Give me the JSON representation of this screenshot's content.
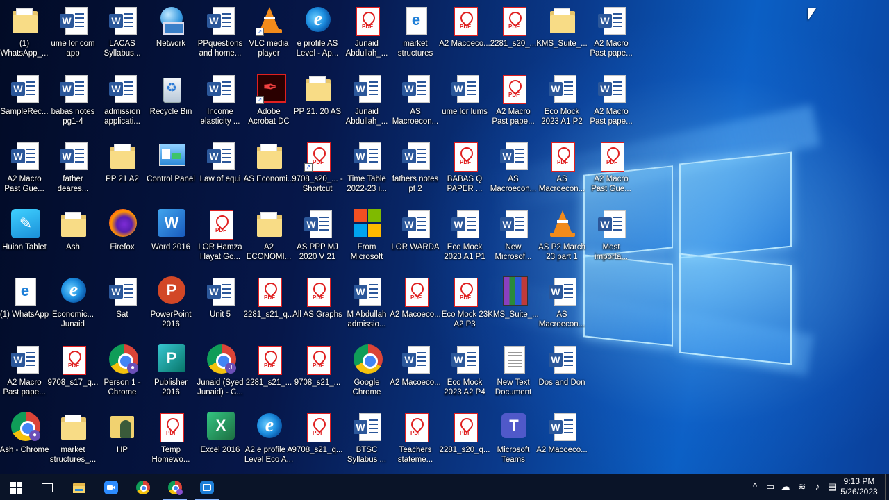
{
  "desktop": {
    "icons": [
      {
        "label": "(1) WhatsApp_...",
        "kind": "folder",
        "col": 0,
        "row": 0
      },
      {
        "label": "ume lor com app",
        "kind": "word",
        "col": 1,
        "row": 0
      },
      {
        "label": "LACAS Syllabus...",
        "kind": "word",
        "col": 2,
        "row": 0
      },
      {
        "label": "Network",
        "kind": "network",
        "col": 3,
        "row": 0
      },
      {
        "label": "PPquestions and home...",
        "kind": "word",
        "col": 4,
        "row": 0
      },
      {
        "label": "VLC media player",
        "kind": "vlc",
        "col": 5,
        "row": 0,
        "shortcut": true
      },
      {
        "label": "e profile AS Level - Ap...",
        "kind": "edge",
        "col": 6,
        "row": 0
      },
      {
        "label": "Junaid Abdullah_...",
        "kind": "pdf",
        "col": 7,
        "row": 0
      },
      {
        "label": "market structures",
        "kind": "edgedoc",
        "col": 8,
        "row": 0
      },
      {
        "label": "A2 Macoeco...",
        "kind": "pdf",
        "col": 9,
        "row": 0
      },
      {
        "label": "2281_s20_...",
        "kind": "pdf",
        "col": 10,
        "row": 0
      },
      {
        "label": "KMS_Suite_...",
        "kind": "folder",
        "col": 11,
        "row": 0
      },
      {
        "label": "A2 Macro Past pape...",
        "kind": "word",
        "col": 12,
        "row": 0
      },
      {
        "label": "SampleRec...",
        "kind": "word",
        "col": 0,
        "row": 1
      },
      {
        "label": "babas notes pg1-4",
        "kind": "word",
        "col": 1,
        "row": 1
      },
      {
        "label": "admission applicati...",
        "kind": "word",
        "col": 2,
        "row": 1
      },
      {
        "label": "Recycle Bin",
        "kind": "recycle",
        "col": 3,
        "row": 1
      },
      {
        "label": "Income elasticity ...",
        "kind": "word",
        "col": 4,
        "row": 1
      },
      {
        "label": "Adobe Acrobat DC",
        "kind": "acrobat",
        "col": 5,
        "row": 1,
        "shortcut": true
      },
      {
        "label": "PP 21. 20 AS",
        "kind": "folder",
        "col": 6,
        "row": 1
      },
      {
        "label": "Junaid Abdullah_...",
        "kind": "word",
        "col": 7,
        "row": 1
      },
      {
        "label": "AS Macroecon...",
        "kind": "word",
        "col": 8,
        "row": 1
      },
      {
        "label": "ume lor lums",
        "kind": "word",
        "col": 9,
        "row": 1
      },
      {
        "label": "A2 Macro Past pape...",
        "kind": "pdf",
        "col": 10,
        "row": 1
      },
      {
        "label": "Eco Mock 2023 A1 P2",
        "kind": "word",
        "col": 11,
        "row": 1
      },
      {
        "label": "A2 Macro Past pape...",
        "kind": "word",
        "col": 12,
        "row": 1
      },
      {
        "label": "A2 Macro Past Gue...",
        "kind": "word",
        "col": 0,
        "row": 2
      },
      {
        "label": "father deares...",
        "kind": "word",
        "col": 1,
        "row": 2
      },
      {
        "label": "PP 21 A2",
        "kind": "folder",
        "col": 2,
        "row": 2
      },
      {
        "label": "Control Panel",
        "kind": "cp",
        "col": 3,
        "row": 2
      },
      {
        "label": "Law of equi",
        "kind": "word",
        "col": 4,
        "row": 2
      },
      {
        "label": "AS Economi...",
        "kind": "folder",
        "col": 5,
        "row": 2
      },
      {
        "label": "9708_s20_... - Shortcut",
        "kind": "pdf",
        "col": 6,
        "row": 2,
        "shortcut": true
      },
      {
        "label": "Time Table 2022-23 i...",
        "kind": "word",
        "col": 7,
        "row": 2
      },
      {
        "label": "fathers notes pt 2",
        "kind": "word",
        "col": 8,
        "row": 2
      },
      {
        "label": "BABAS Q PAPER ...",
        "kind": "pdf",
        "col": 9,
        "row": 2
      },
      {
        "label": "AS Macroecon...",
        "kind": "word",
        "col": 10,
        "row": 2
      },
      {
        "label": "AS Macroecon...",
        "kind": "pdf",
        "col": 11,
        "row": 2
      },
      {
        "label": "A2 Macro Past Gue...",
        "kind": "pdf",
        "col": 12,
        "row": 2
      },
      {
        "label": "Huion Tablet",
        "kind": "huion",
        "col": 0,
        "row": 3
      },
      {
        "label": "Ash",
        "kind": "folder",
        "col": 1,
        "row": 3
      },
      {
        "label": "Firefox",
        "kind": "firefox",
        "col": 2,
        "row": 3
      },
      {
        "label": "Word 2016",
        "kind": "wordapp",
        "col": 3,
        "row": 3
      },
      {
        "label": "LOR Hamza Hayat Go...",
        "kind": "pdf",
        "col": 4,
        "row": 3
      },
      {
        "label": "A2 ECONOMI...",
        "kind": "folder",
        "col": 5,
        "row": 3
      },
      {
        "label": "AS PPP MJ 2020 V 21",
        "kind": "word",
        "col": 6,
        "row": 3
      },
      {
        "label": "From Microsoft",
        "kind": "ms",
        "col": 7,
        "row": 3
      },
      {
        "label": "LOR WARDA",
        "kind": "word",
        "col": 8,
        "row": 3
      },
      {
        "label": "Eco Mock 2023 A1 P1",
        "kind": "word",
        "col": 9,
        "row": 3
      },
      {
        "label": "New Microsof...",
        "kind": "word",
        "col": 10,
        "row": 3
      },
      {
        "label": "AS P2 March 23 part 1",
        "kind": "vlc",
        "col": 11,
        "row": 3
      },
      {
        "label": "Most importa...",
        "kind": "word",
        "col": 12,
        "row": 3
      },
      {
        "label": "(1) WhatsApp",
        "kind": "edgedoc",
        "col": 0,
        "row": 4
      },
      {
        "label": "Economic... Junaid",
        "kind": "edge",
        "col": 1,
        "row": 4
      },
      {
        "label": "Sat",
        "kind": "word",
        "col": 2,
        "row": 4
      },
      {
        "label": "PowerPoint 2016",
        "kind": "ppt",
        "col": 3,
        "row": 4
      },
      {
        "label": "Unit 5",
        "kind": "word",
        "col": 4,
        "row": 4
      },
      {
        "label": "2281_s21_q...",
        "kind": "pdf",
        "col": 5,
        "row": 4
      },
      {
        "label": "All AS Graphs",
        "kind": "pdf",
        "col": 6,
        "row": 4
      },
      {
        "label": "M Abdullah admissio...",
        "kind": "word",
        "col": 7,
        "row": 4
      },
      {
        "label": "A2 Macoeco...",
        "kind": "pdf",
        "col": 8,
        "row": 4
      },
      {
        "label": "Eco Mock 23 A2 P3",
        "kind": "pdf",
        "col": 9,
        "row": 4
      },
      {
        "label": "KMS_Suite_...",
        "kind": "winrar",
        "col": 10,
        "row": 4
      },
      {
        "label": "AS Macroecon...",
        "kind": "word",
        "col": 11,
        "row": 4
      },
      {
        "label": "A2 Macro Past pape...",
        "kind": "word",
        "col": 0,
        "row": 5
      },
      {
        "label": "9708_s17_q...",
        "kind": "pdf",
        "col": 1,
        "row": 5
      },
      {
        "label": "Person 1 - Chrome",
        "kind": "chrome",
        "col": 2,
        "row": 5,
        "avatar": "●"
      },
      {
        "label": "Publisher 2016",
        "kind": "publisher",
        "col": 3,
        "row": 5
      },
      {
        "label": "Junaid (Syed Junaid) - C...",
        "kind": "chrome",
        "col": 4,
        "row": 5,
        "avatar": "J"
      },
      {
        "label": "2281_s21_...",
        "kind": "pdf",
        "col": 5,
        "row": 5
      },
      {
        "label": "9708_s21_...",
        "kind": "pdf",
        "col": 6,
        "row": 5
      },
      {
        "label": "Google Chrome",
        "kind": "chrome",
        "col": 7,
        "row": 5
      },
      {
        "label": "A2 Macoeco...",
        "kind": "word",
        "col": 8,
        "row": 5
      },
      {
        "label": "Eco Mock 2023 A2 P4",
        "kind": "word",
        "col": 9,
        "row": 5
      },
      {
        "label": "New Text Document",
        "kind": "txt",
        "col": 10,
        "row": 5
      },
      {
        "label": "Dos and Don",
        "kind": "word",
        "col": 11,
        "row": 5
      },
      {
        "label": "Ash - Chrome",
        "kind": "chrome",
        "col": 0,
        "row": 6,
        "avatar": "●"
      },
      {
        "label": "market structures_...",
        "kind": "folder",
        "col": 1,
        "row": 6
      },
      {
        "label": "HP",
        "kind": "hp",
        "col": 2,
        "row": 6
      },
      {
        "label": "Temp Homewo...",
        "kind": "pdf",
        "col": 3,
        "row": 6
      },
      {
        "label": "Excel 2016",
        "kind": "excel",
        "col": 4,
        "row": 6
      },
      {
        "label": "A2 e profile A Level Eco A...",
        "kind": "edge",
        "col": 5,
        "row": 6
      },
      {
        "label": "9708_s21_q...",
        "kind": "pdf",
        "col": 6,
        "row": 6
      },
      {
        "label": "BTSC Syllabus ...",
        "kind": "word",
        "col": 7,
        "row": 6
      },
      {
        "label": "Teachers stateme...",
        "kind": "pdf",
        "col": 8,
        "row": 6
      },
      {
        "label": "2281_s20_q...",
        "kind": "pdf",
        "col": 9,
        "row": 6
      },
      {
        "label": "Microsoft Teams",
        "kind": "teams",
        "col": 10,
        "row": 6
      },
      {
        "label": "A2 Macoeco...",
        "kind": "word",
        "col": 11,
        "row": 6
      }
    ]
  },
  "taskbar": {
    "buttons": [
      {
        "name": "start-button",
        "icon": "windows-icon"
      },
      {
        "name": "task-view-button",
        "icon": "task-view-icon"
      },
      {
        "name": "file-explorer-button",
        "icon": "folder-icon"
      },
      {
        "name": "zoom-button",
        "icon": "zoom-icon"
      },
      {
        "name": "chrome-button",
        "icon": "chrome-icon"
      },
      {
        "name": "chrome-profile-button",
        "icon": "chrome-profile-icon",
        "active": true
      },
      {
        "name": "screen-recorder-button",
        "icon": "recorder-icon",
        "active": true
      }
    ],
    "tray": {
      "chevron": "^",
      "time": "9:13 PM",
      "date": "5/26/2023"
    }
  },
  "colors": {
    "taskbar": "#0a1428",
    "word": "#2b579a",
    "pdf": "#e02020",
    "excel": "#1d6f42",
    "publisher": "#077568",
    "accent": "#0b5fc4"
  }
}
